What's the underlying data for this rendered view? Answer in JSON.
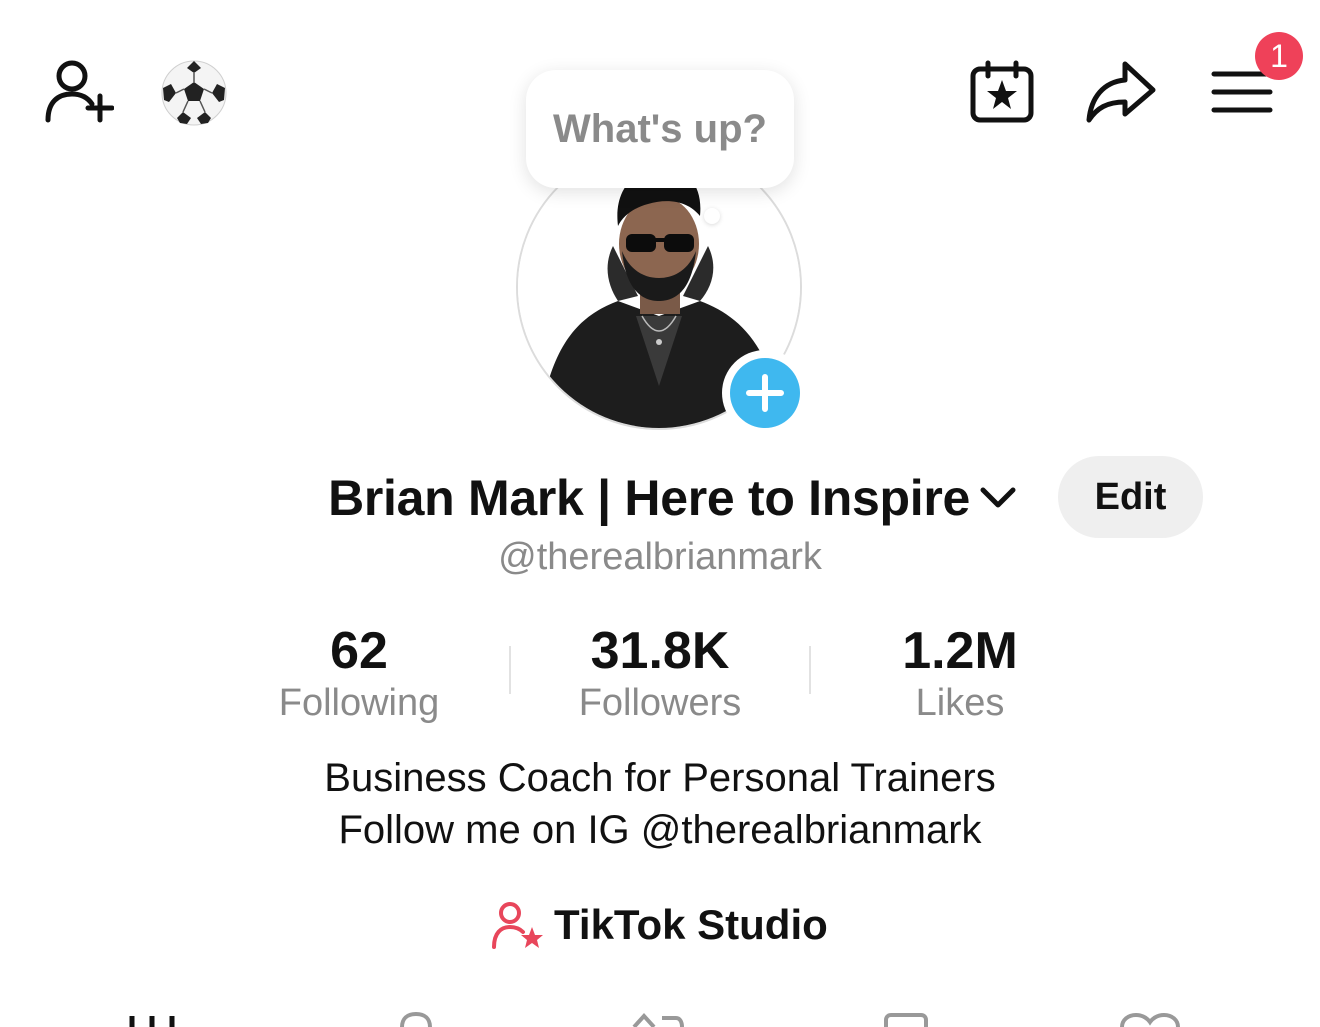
{
  "header": {
    "notification_count": "1"
  },
  "icons": {
    "add_friend": "add-user-icon",
    "soccer": "soccer-ball-icon",
    "calendar": "calendar-star-icon",
    "share": "share-arrow-icon",
    "menu": "hamburger-menu-icon",
    "avatar_add": "plus-icon",
    "chevron": "chevron-down-icon",
    "studio": "user-star-icon"
  },
  "status_bubble": {
    "placeholder": "What's up?"
  },
  "profile": {
    "display_name": "Brian Mark | Here to Inspire",
    "handle": "@therealbrianmark",
    "edit_label": "Edit"
  },
  "stats": [
    {
      "value": "62",
      "label": "Following"
    },
    {
      "value": "31.8K",
      "label": "Followers"
    },
    {
      "value": "1.2M",
      "label": "Likes"
    }
  ],
  "bio": {
    "line1": "Business Coach for Personal Trainers",
    "line2": "Follow me on IG @therealbrianmark"
  },
  "studio": {
    "label": "TikTok Studio"
  },
  "colors": {
    "badge": "#ef4159",
    "accent_blue": "#3fb8ef",
    "secondary_text": "#8a8a8a",
    "studio_icon": "#e8465b"
  }
}
